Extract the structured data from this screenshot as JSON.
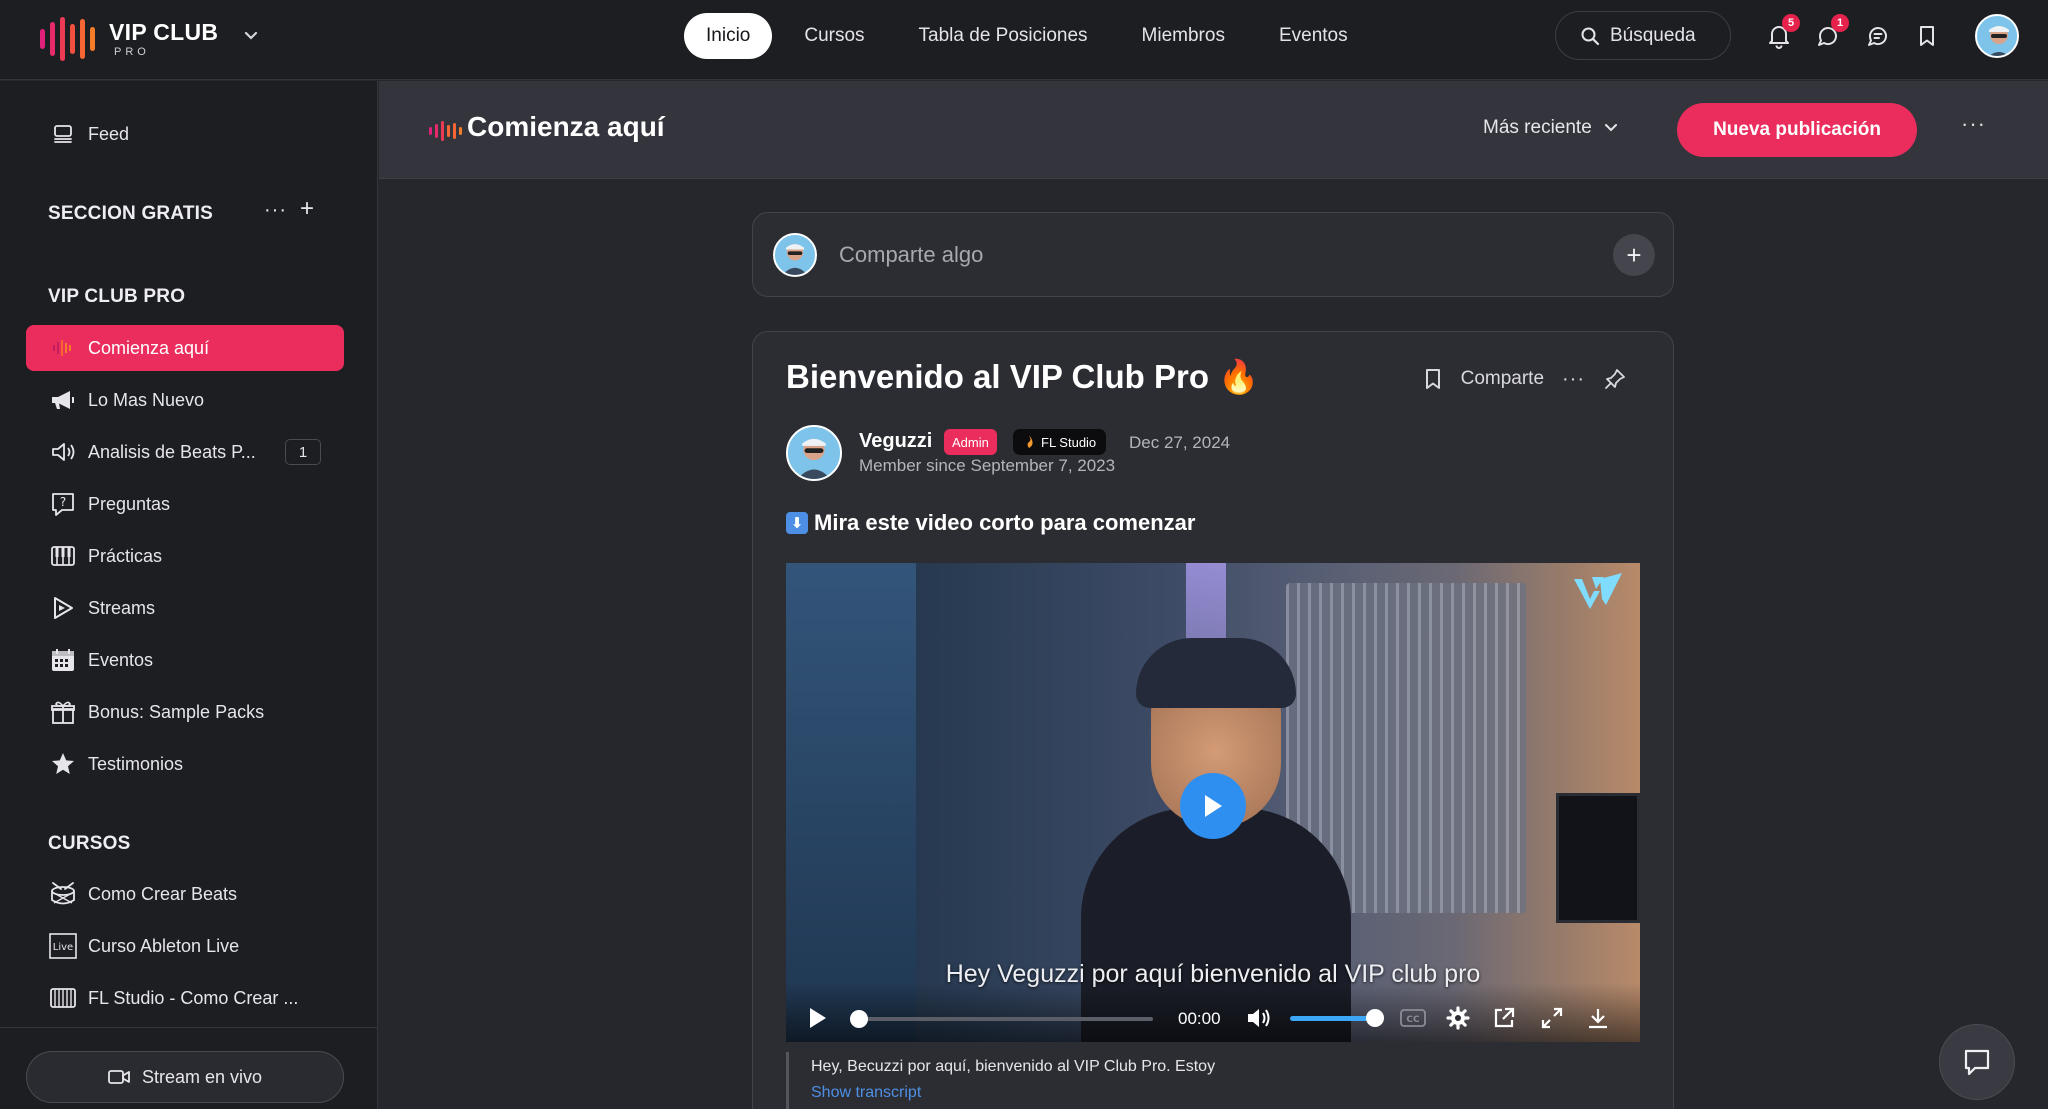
{
  "brand": {
    "title": "VIP CLUB",
    "subtitle": "PRO"
  },
  "nav": {
    "items": [
      "Inicio",
      "Cursos",
      "Tabla de Posiciones",
      "Miembros",
      "Eventos"
    ],
    "active": "Inicio"
  },
  "search": {
    "label": "Búsqueda"
  },
  "notifications": {
    "bell_count": "5",
    "messages_count": "1"
  },
  "sidebar": {
    "feed": "Feed",
    "section_free": "SECCION GRATIS",
    "section_vip": "VIP CLUB PRO",
    "vip_items": [
      {
        "label": "Comienza aquí",
        "icon": "brand-bars-icon",
        "active": true
      },
      {
        "label": "Lo Mas Nuevo",
        "icon": "megaphone-icon"
      },
      {
        "label": "Analisis de Beats P...",
        "icon": "speaker-icon",
        "count": "1"
      },
      {
        "label": "Preguntas",
        "icon": "question-icon"
      },
      {
        "label": "Prácticas",
        "icon": "piano-icon"
      },
      {
        "label": "Streams",
        "icon": "play-icon"
      },
      {
        "label": "Eventos",
        "icon": "calendar-icon"
      },
      {
        "label": "Bonus: Sample Packs",
        "icon": "gift-icon"
      },
      {
        "label": "Testimonios",
        "icon": "star-icon"
      }
    ],
    "section_courses": "CURSOS",
    "course_items": [
      {
        "label": "Como Crear Beats",
        "icon": "drum-icon"
      },
      {
        "label": "Curso Ableton Live",
        "icon": "ableton-live-icon"
      },
      {
        "label": "FL Studio - Como Crear ...",
        "icon": "keyboard-icon"
      }
    ],
    "stream_button": "Stream en vivo"
  },
  "header": {
    "title": "Comienza aquí",
    "sort": "Más reciente",
    "new_post": "Nueva publicación"
  },
  "composer": {
    "placeholder": "Comparte algo"
  },
  "post": {
    "title": "Bienvenido al VIP Club Pro 🔥",
    "share": "Comparte",
    "author": "Veguzzi",
    "badge_admin": "Admin",
    "badge_fl": "FL Studio",
    "date": "Dec 27, 2024",
    "member_since": "Member since September 7, 2023",
    "intro": "Mira este video corto para comenzar",
    "video": {
      "caption": "Hey Veguzzi por aquí bienvenido al VIP club pro",
      "time": "00:00",
      "progress": 0,
      "volume": 1.0
    },
    "transcript": "Hey, Becuzzi por aquí, bienvenido al VIP Club Pro. Estoy",
    "show_transcript": "Show transcript"
  },
  "colors": {
    "accent": "#ea2d5c",
    "link": "#4e8fe6",
    "video_accent": "#2f8ff0"
  }
}
